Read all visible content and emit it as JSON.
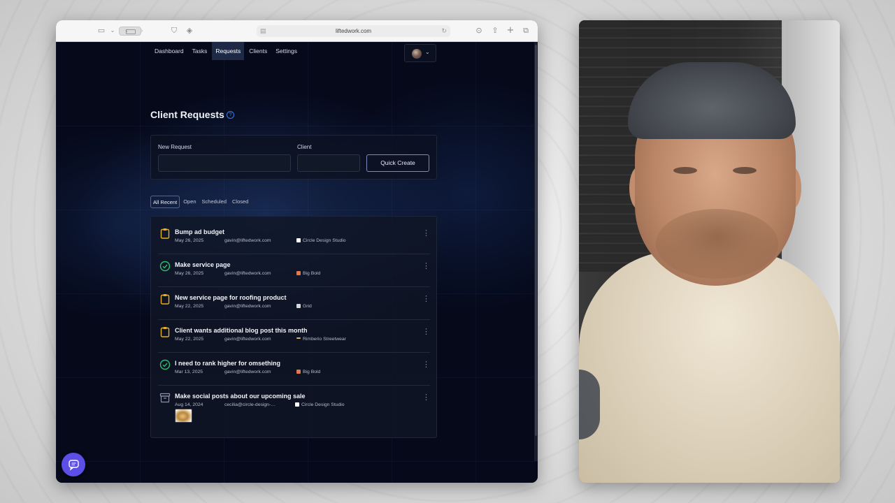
{
  "browser": {
    "url": "liftedwork.com"
  },
  "nav": {
    "items": [
      {
        "label": "Dashboard",
        "active": false
      },
      {
        "label": "Tasks",
        "active": false
      },
      {
        "label": "Requests",
        "active": true
      },
      {
        "label": "Clients",
        "active": false
      },
      {
        "label": "Settings",
        "active": false
      }
    ]
  },
  "page": {
    "title": "Client Requests",
    "help_icon": "?"
  },
  "create_form": {
    "new_request_label": "New Request",
    "new_request_value": "",
    "client_label": "Client",
    "client_value": "",
    "quick_create_label": "Quick Create"
  },
  "filters": {
    "tabs": [
      {
        "label": "All Recent",
        "active": true
      },
      {
        "label": "Open",
        "active": false
      },
      {
        "label": "Scheduled",
        "active": false
      },
      {
        "label": "Closed",
        "active": false
      }
    ]
  },
  "requests": [
    {
      "title": "Bump ad budget",
      "date": "May 26, 2025",
      "email": "gavin@liftedwork.com",
      "client": "Circle Design Studio",
      "status_icon": "clipboard-icon",
      "client_color": "#ffffff"
    },
    {
      "title": "Make service page",
      "date": "May 26, 2025",
      "email": "gavin@liftedwork.com",
      "client": "Big Bold",
      "status_icon": "check-circle-icon",
      "client_color": "#e07a4a"
    },
    {
      "title": "New service page for roofing product",
      "date": "May 22, 2025",
      "email": "gavin@liftedwork.com",
      "client": "Grid",
      "status_icon": "clipboard-icon",
      "client_color": "#d9d9d9"
    },
    {
      "title": "Client wants additional blog post this month",
      "date": "May 22, 2025",
      "email": "gavin@liftedwork.com",
      "client": "Rimberio Streetwear",
      "status_icon": "clipboard-icon",
      "client_color": "#e0b070"
    },
    {
      "title": "I need to rank higher for omsething",
      "date": "Mar 13, 2025",
      "email": "gavin@liftedwork.com",
      "client": "Big Bold",
      "status_icon": "check-circle-icon",
      "client_color": "#e07a4a"
    },
    {
      "title": "Make social posts about our upcoming sale",
      "date": "Aug 14, 2024",
      "email": "cecilia@circle-design-studio.com",
      "client": "Circle Design Studio",
      "status_icon": "archive-icon",
      "client_color": "#ffffff"
    }
  ],
  "colors": {
    "accent": "#5b4fe8",
    "status_pending": "#e9b019",
    "status_done": "#2fbf6a"
  }
}
